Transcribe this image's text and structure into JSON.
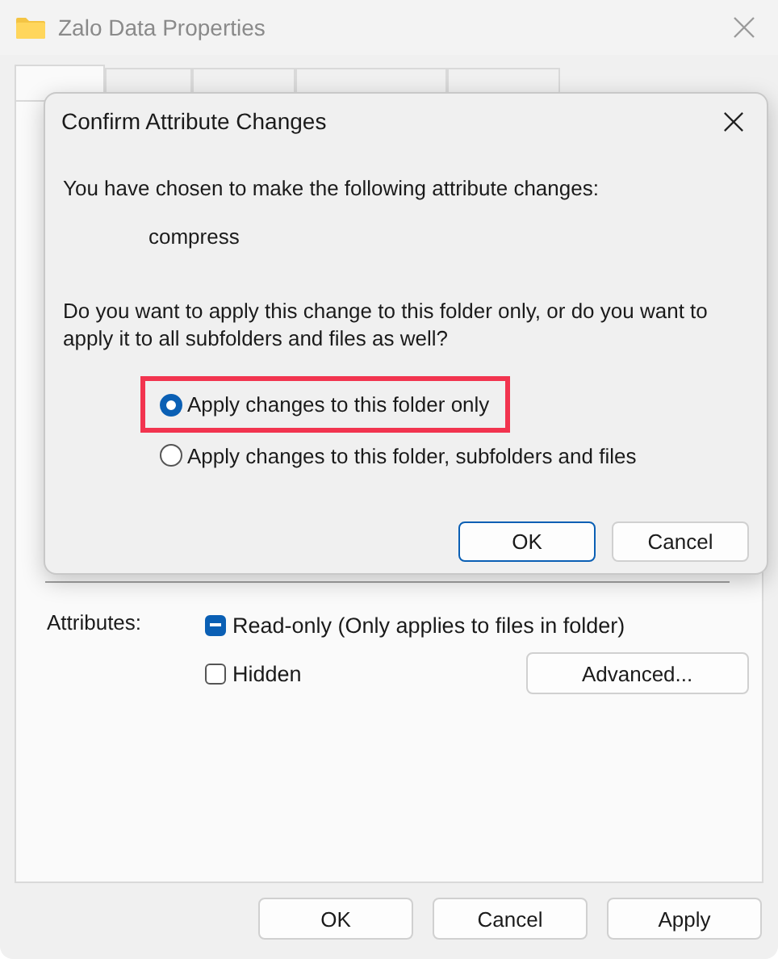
{
  "window": {
    "title": "Zalo Data Properties"
  },
  "tabs": [
    {
      "selected": true
    },
    {
      "selected": false
    },
    {
      "selected": false
    },
    {
      "selected": false
    },
    {
      "selected": false
    }
  ],
  "attributes": {
    "label": "Attributes:",
    "items": [
      {
        "label": "Read-only (Only applies to files in folder)",
        "indeterminate": true
      },
      {
        "label": "Hidden",
        "checked": false,
        "indeterminate": false
      }
    ],
    "advanced_button": "Advanced..."
  },
  "buttons": [
    "OK",
    "Cancel",
    "Apply"
  ],
  "dialog": {
    "title": "Confirm Attribute Changes",
    "intro": "You have chosen to make the following attribute changes:",
    "change": "compress",
    "question": "Do you want to apply this change to this folder only, or do you want to apply it to all subfolders and files as well?",
    "options": [
      {
        "label": "Apply changes to this folder only",
        "selected": true,
        "highlighted": true
      },
      {
        "label": "Apply changes to this folder, subfolders and files",
        "selected": false,
        "highlighted": false
      }
    ],
    "buttons": [
      {
        "label": "OK",
        "default": true
      },
      {
        "label": "Cancel",
        "default": false
      }
    ]
  }
}
